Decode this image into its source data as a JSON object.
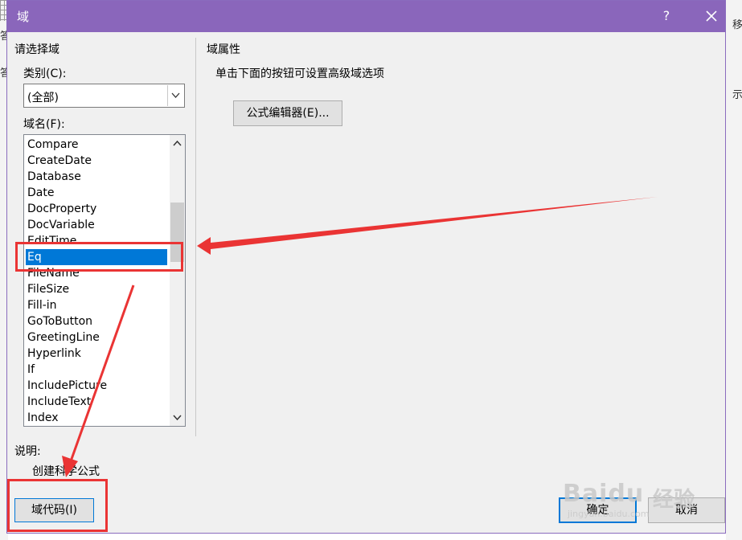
{
  "background": {
    "left_chars": [
      "答",
      "答"
    ],
    "right_chars": [
      "移",
      "示"
    ]
  },
  "dialog": {
    "title": "域",
    "help": "?",
    "select_field_group": "请选择域",
    "category_label": "类别(C):",
    "category_value": "(全部)",
    "field_names_label": "域名(F):",
    "field_names": [
      "Compare",
      "CreateDate",
      "Database",
      "Date",
      "DocProperty",
      "DocVariable",
      "EditTime",
      "Eq",
      "FileName",
      "FileSize",
      "Fill-in",
      "GoToButton",
      "GreetingLine",
      "Hyperlink",
      "If",
      "IncludePicture",
      "IncludeText",
      "Index"
    ],
    "selected_field": "Eq",
    "description_label": "说明:",
    "description_text": "创建科学公式",
    "field_codes_button": "域代码(I)",
    "field_properties_group": "域属性",
    "properties_hint": "单击下面的按钮可设置高级域选项",
    "formula_editor_button": "公式编辑器(E)...",
    "ok_button": "确定",
    "cancel_button": "取消"
  },
  "watermark": {
    "brand": "Baidu",
    "brand_cn": "经验",
    "url": "jingyan.baidu.com"
  },
  "colors": {
    "titlebar": "#8a66bb",
    "selection": "#0078d7",
    "annotation": "#ea3434"
  }
}
